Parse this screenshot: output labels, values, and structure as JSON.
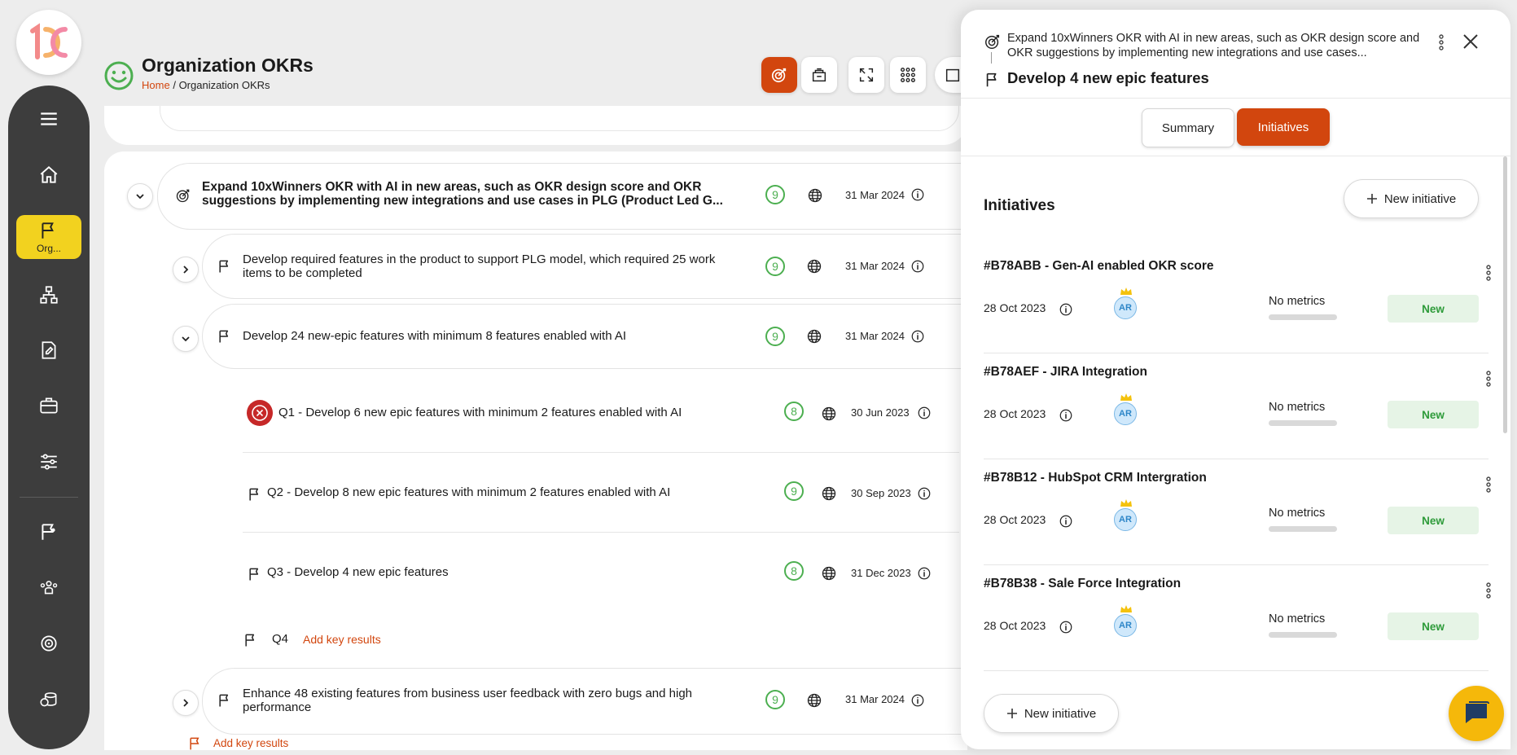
{
  "header": {
    "title": "Organization OKRs",
    "breadcrumb_home": "Home",
    "breadcrumb_sep": "/",
    "breadcrumb_current": "Organization OKRs"
  },
  "sidebar": {
    "items": [
      {
        "icon": "menu-icon"
      },
      {
        "icon": "home-icon"
      },
      {
        "icon": "flag-icon",
        "label": "Org...",
        "active": true
      },
      {
        "icon": "org-chart-icon"
      },
      {
        "icon": "edit-doc-icon"
      },
      {
        "icon": "briefcase-icon"
      },
      {
        "icon": "sliders-icon"
      },
      {
        "icon": "flag-person-icon"
      },
      {
        "icon": "team-icon"
      },
      {
        "icon": "target-icon"
      },
      {
        "icon": "coins-icon"
      }
    ]
  },
  "toolbar": {
    "buttons": [
      "target-icon",
      "archive-icon",
      "expand-icon",
      "grid-icon",
      "calendar-icon"
    ]
  },
  "objective": {
    "title": "Expand 10xWinners OKR with AI in new areas, such as OKR design score and OKR suggestions by implementing new integrations and use cases in PLG (Product Led G...",
    "count": "9",
    "date": "31 Mar 2024"
  },
  "key_results": [
    {
      "title": "Develop required features in the product to support PLG model, which required 25 work items to be completed",
      "count": "9",
      "date": "31 Mar 2024"
    },
    {
      "title": "Develop 24 new-epic features with minimum 8 features enabled with AI",
      "count": "9",
      "date": "31 Mar 2024"
    },
    {
      "title": "Enhance 48 existing features from business user feedback with zero bugs and high performance",
      "count": "9",
      "date": "31 Mar 2024"
    }
  ],
  "quarters": [
    {
      "title": "Q1 - Develop 6 new epic features with minimum 2 features enabled with AI",
      "count": "8",
      "date": "30 Jun 2023"
    },
    {
      "title": "Q2 - Develop 8 new epic features with minimum 2 features enabled with AI",
      "count": "9",
      "date": "30 Sep 2023"
    },
    {
      "title": "Q3 - Develop 4 new epic features",
      "count": "8",
      "date": "31 Dec 2023"
    },
    {
      "title": "Q4",
      "add_label": "Add key results"
    }
  ],
  "bottom_add_label": "Add key results",
  "panel": {
    "parent": "Expand 10xWinners OKR with AI in new areas, such as OKR design score and OKR suggestions by implementing new integrations and use cases...",
    "title": "Develop 4 new epic features",
    "tabs": {
      "summary": "Summary",
      "initiatives": "Initiatives"
    },
    "section_title": "Initiatives",
    "new_initiative": "New initiative",
    "initiatives": [
      {
        "title": "#B78ABB - Gen-AI enabled OKR score",
        "date": "28 Oct 2023",
        "avatar": "AR",
        "metrics": "No metrics",
        "status": "New"
      },
      {
        "title": "#B78AEF - JIRA Integration",
        "date": "28 Oct 2023",
        "avatar": "AR",
        "metrics": "No metrics",
        "status": "New"
      },
      {
        "title": "#B78B12 - HubSpot CRM Intergration",
        "date": "28 Oct 2023",
        "avatar": "AR",
        "metrics": "No metrics",
        "status": "New"
      },
      {
        "title": "#B78B38 - Sale Force Integration",
        "date": "28 Oct 2023",
        "avatar": "AR",
        "metrics": "No metrics",
        "status": "New"
      }
    ]
  },
  "colors": {
    "accent": "#d2460e",
    "sidebar": "#3d3d3d",
    "active_nav": "#f2d21f",
    "count": "#4caf50",
    "status_new_bg": "#e6f4e6"
  }
}
